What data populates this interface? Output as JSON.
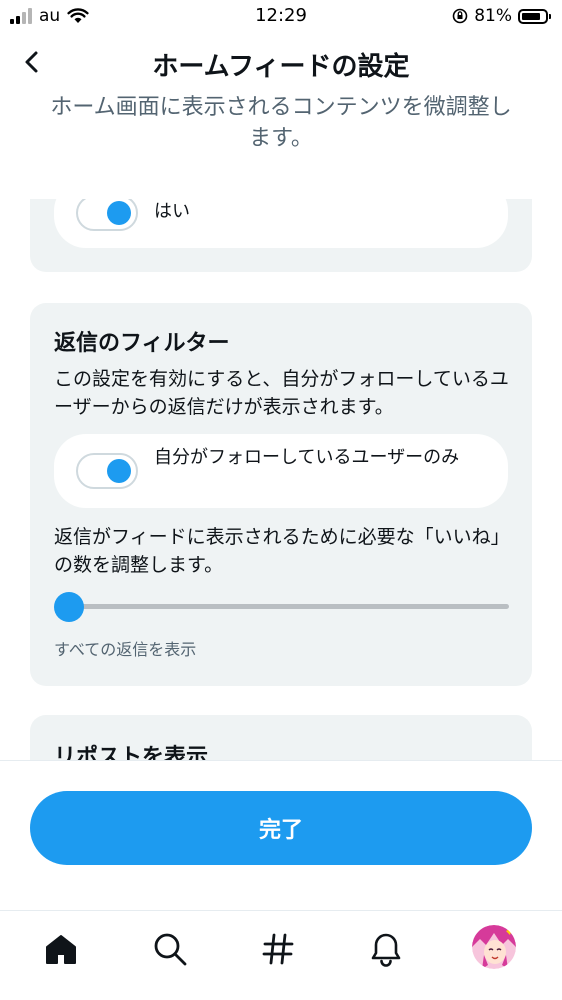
{
  "status_bar": {
    "carrier": "au",
    "time": "12:29",
    "battery_percent": "81%",
    "battery_level": 0.81
  },
  "header": {
    "title": "ホームフィードの設定",
    "subtitle": "ホーム画面に表示されるコンテンツを微調整します。"
  },
  "card_top": {
    "toggle_label": "はい",
    "toggle_on": true
  },
  "replies_filter": {
    "heading": "返信のフィルター",
    "description": "この設定を有効にすると、自分がフォローしているユーザーからの返信だけが表示されます。",
    "toggle_label": "自分がフォローしているユーザーのみ",
    "toggle_on": true,
    "likes_description": "返信がフィードに表示されるために必要な「いいね」の数を調整します。",
    "slider_value": 0,
    "slider_caption": "すべての返信を表示"
  },
  "reposts": {
    "heading": "リポストを表示"
  },
  "footer": {
    "done_label": "完了"
  },
  "tab_bar": {
    "icons": [
      "home-icon",
      "search-icon",
      "hashtag-icon",
      "notifications-icon",
      "avatar"
    ]
  },
  "colors": {
    "accent": "#1d9bf0",
    "card_bg": "#eff3f4",
    "secondary_text": "#536471"
  }
}
